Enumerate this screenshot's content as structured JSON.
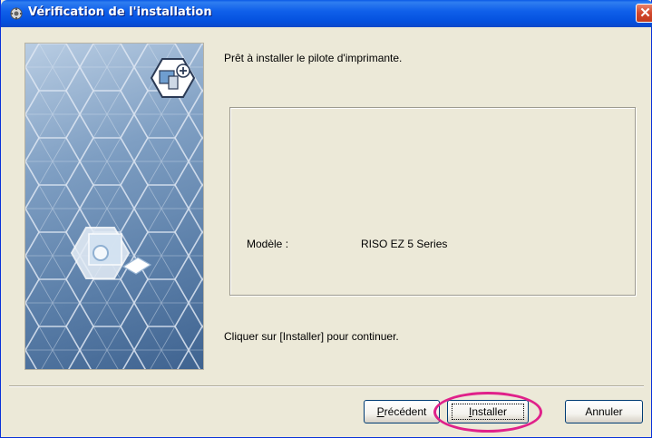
{
  "window": {
    "title": "Vérification de l'installation",
    "close_symbol": "✕"
  },
  "content": {
    "ready_text": "Prêt à installer le pilote d'imprimante.",
    "model_label": "Modèle :",
    "model_value": "RISO EZ 5 Series",
    "continue_text": "Cliquer sur [Installer] pour continuer."
  },
  "buttons": {
    "previous_prefix": "P",
    "previous_rest": "récédent",
    "install_prefix": "I",
    "install_rest": "nstaller",
    "cancel": "Annuler"
  },
  "colors": {
    "title_bar": "#0450de",
    "dialog_bg": "#ece9d8",
    "highlight": "#e0218a",
    "close_button": "#d2482d"
  },
  "icons": {
    "title": "installer-icon",
    "close": "close-icon",
    "art_computer": "computer-add-icon",
    "art_printer": "printer-icon"
  }
}
